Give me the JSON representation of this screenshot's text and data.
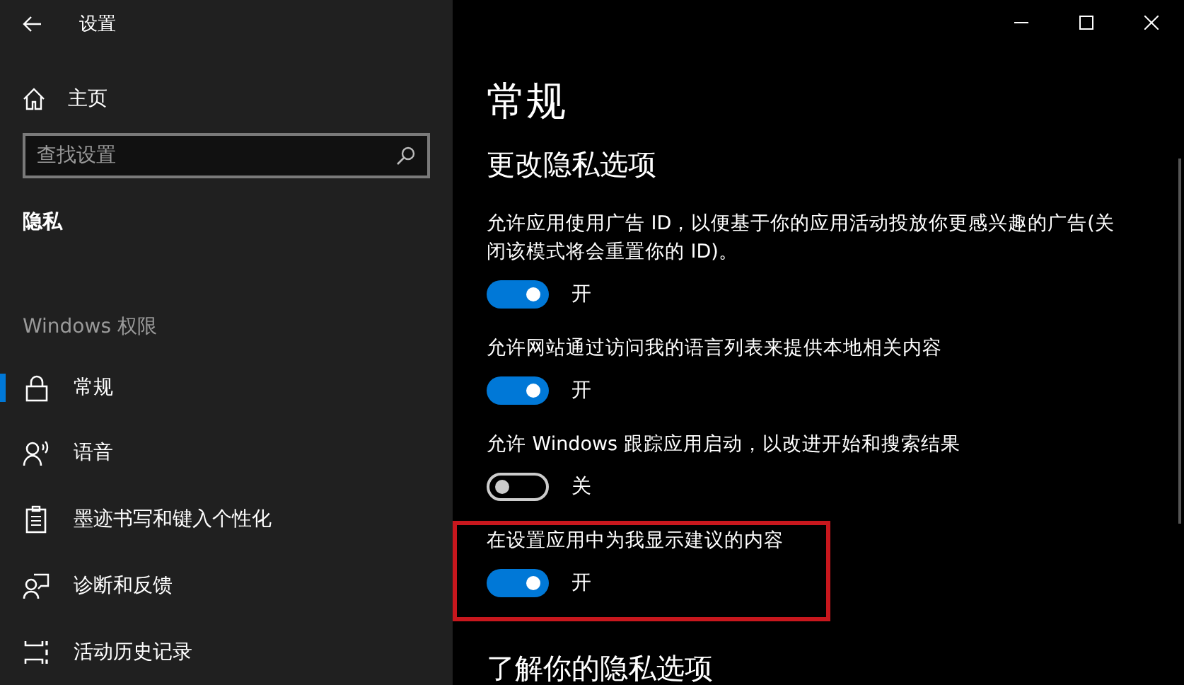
{
  "window": {
    "title": "设置"
  },
  "sidebar": {
    "home": "主页",
    "search": {
      "placeholder": "查找设置"
    },
    "section": "隐私",
    "group": "Windows 权限",
    "items": [
      {
        "label": "常规",
        "kind": "lock",
        "selected": true
      },
      {
        "label": "语音",
        "kind": "voice",
        "selected": false
      },
      {
        "label": "墨迹书写和键入个性化",
        "kind": "clipboard",
        "selected": false
      },
      {
        "label": "诊断和反馈",
        "kind": "feedback",
        "selected": false
      },
      {
        "label": "活动历史记录",
        "kind": "timeline",
        "selected": false
      }
    ]
  },
  "content": {
    "title": "常规",
    "heading": "更改隐私选项",
    "settings": [
      {
        "text": "允许应用使用广告 ID，以便基于你的应用活动投放你更感兴趣的广告(关闭该模式将会重置你的 ID)。",
        "on": true,
        "state": "开",
        "highlighted": false
      },
      {
        "text": "允许网站通过访问我的语言列表来提供本地相关内容",
        "on": true,
        "state": "开",
        "highlighted": false
      },
      {
        "text": "允许 Windows 跟踪应用启动，以改进开始和搜索结果",
        "on": false,
        "state": "关",
        "highlighted": false
      },
      {
        "text": "在设置应用中为我显示建议的内容",
        "on": true,
        "state": "开",
        "highlighted": true
      }
    ],
    "footer_heading": "了解你的隐私选项"
  }
}
